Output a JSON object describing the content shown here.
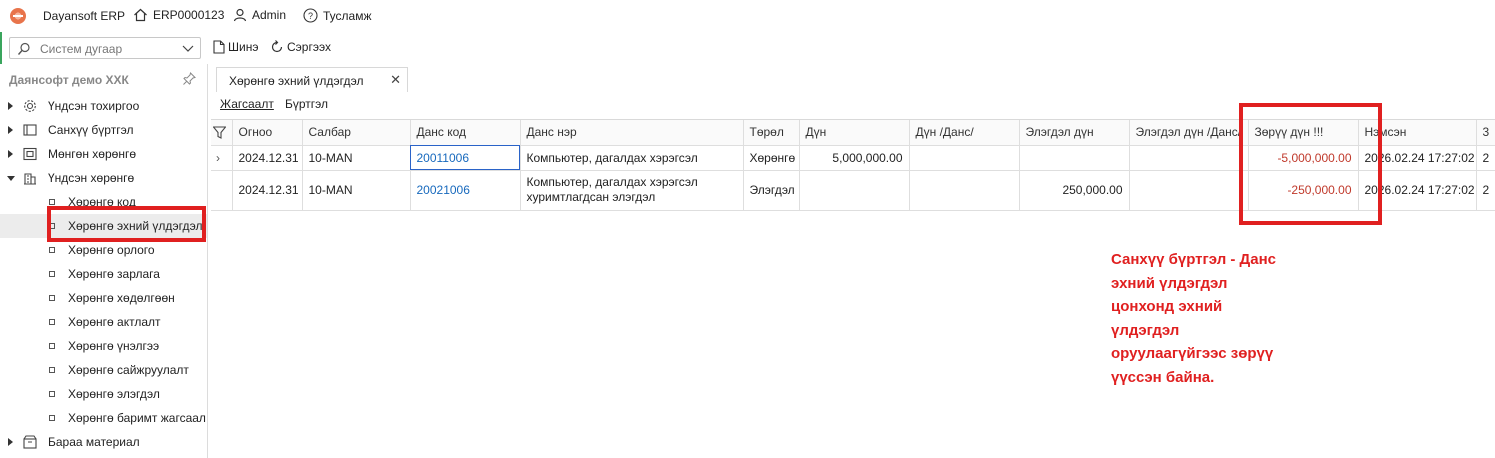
{
  "topbar": {
    "app_name": "Dayansoft ERP",
    "company_code": "ERP0000123",
    "user": "Admin",
    "help": "Тусламж"
  },
  "toolbar": {
    "search_placeholder": "Систем дугаар",
    "new_label": "Шинэ",
    "refresh_label": "Сэргээх"
  },
  "sidebar": {
    "company": "Даянсофт демо ХХК",
    "items": [
      {
        "label": "Үндсэн тохиргоо",
        "icon": "gear-icon"
      },
      {
        "label": "Санхүү бүртгэл",
        "icon": "ledger-icon"
      },
      {
        "label": "Мөнгөн хөрөнгө",
        "icon": "cash-icon"
      },
      {
        "label": "Үндсэн хөрөнгө",
        "icon": "building-icon"
      }
    ],
    "subitems": [
      "Хөрөнгө код",
      "Хөрөнгө эхний үлдэгдэл",
      "Хөрөнгө орлого",
      "Хөрөнгө зарлага",
      "Хөрөнгө хөдөлгөөн",
      "Хөрөнгө актлалт",
      "Хөрөнгө үнэлгээ",
      "Хөрөнгө сайжруулалт",
      "Хөрөнгө элэгдэл",
      "Хөрөнгө баримт жагсаал"
    ],
    "last_item": {
      "label": "Бараа материал",
      "icon": "box-icon"
    }
  },
  "tab": {
    "title": "Хөрөнгө эхний үлдэгдэл"
  },
  "subtabs": [
    "Жагсаалт",
    "Бүртгэл"
  ],
  "grid": {
    "columns": [
      "Огноо",
      "Салбар",
      "Данс код",
      "Данс нэр",
      "Төрөл",
      "Дүн",
      "Дүн /Данс/",
      "Элэгдэл дүн",
      "Элэгдэл дүн /Данс/",
      "Зөрүү дүн !!!",
      "Нэмсэн",
      "3"
    ],
    "rows": [
      {
        "date": "2024.12.31",
        "branch": "10-MAN",
        "acct_code": "20011006",
        "acct_name_1": "Компьютер, дагалдах хэрэгсэл",
        "acct_name_2": "",
        "type": "Хөрөнгө",
        "amount": "5,000,000.00",
        "amount_acct": "",
        "depr": "",
        "depr_acct": "",
        "diff": "-5,000,000.00",
        "added": "2026.02.24 17:27:02",
        "extra": "2"
      },
      {
        "date": "2024.12.31",
        "branch": "10-MAN",
        "acct_code": "20021006",
        "acct_name_1": "Компьютер, дагалдах хэрэгсэл",
        "acct_name_2": "хуримтлагдсан элэгдэл",
        "type": "Элэгдэл",
        "amount": "",
        "amount_acct": "",
        "depr": "250,000.00",
        "depr_acct": "",
        "diff": "-250,000.00",
        "added": "2026.02.24 17:27:02",
        "extra": "2"
      }
    ]
  },
  "annotation": {
    "lines": [
      "Санхүү бүртгэл - Данс",
      "эхний үлдэгдэл",
      "цонхонд эхний",
      "үлдэгдэл",
      "оруулаагүйгээс зөрүү",
      "үүссэн байна."
    ]
  },
  "colors": {
    "annotation_red": "#e02020",
    "link_blue": "#1769bd",
    "negative_red": "#c0392b"
  }
}
